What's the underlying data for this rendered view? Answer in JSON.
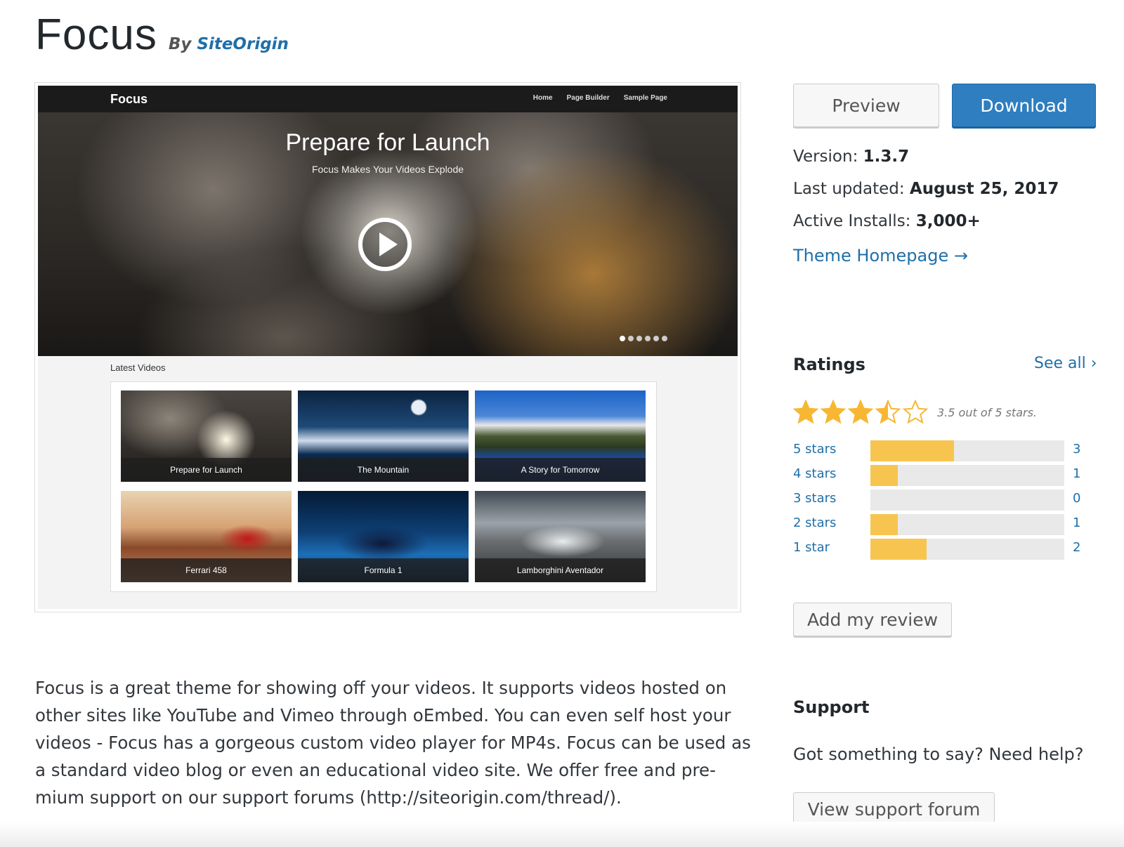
{
  "header": {
    "theme_name": "Focus",
    "by_label": "By",
    "author": "SiteOrigin"
  },
  "screenshot": {
    "site_title": "Focus",
    "menu": [
      "Home",
      "Page Builder",
      "Sample Page"
    ],
    "hero_title": "Prepare for Launch",
    "hero_subtitle": "Focus Makes Your Videos Explode",
    "slider_dots": 6,
    "latest_label": "Latest Videos",
    "videos": [
      "Prepare for Launch",
      "The Mountain",
      "A Story for Tomorrow",
      "Ferrari 458",
      "Formula 1",
      "Lamborghini Aventador"
    ]
  },
  "actions": {
    "preview_label": "Preview",
    "download_label": "Download"
  },
  "meta": {
    "version_label": "Version:",
    "version": "1.3.7",
    "updated_label": "Last updated:",
    "updated": "August 25, 2017",
    "installs_label": "Active Installs:",
    "installs": "3,000+",
    "homepage_label": "Theme Homepage →"
  },
  "ratings": {
    "title": "Ratings",
    "see_all": "See all ›",
    "average": 3.5,
    "stars_text": "3.5 out of 5 stars.",
    "rows": [
      {
        "label": "5 stars",
        "count": "3",
        "fraction": 0.43
      },
      {
        "label": "4 stars",
        "count": "1",
        "fraction": 0.14
      },
      {
        "label": "3 stars",
        "count": "0",
        "fraction": 0
      },
      {
        "label": "2 stars",
        "count": "1",
        "fraction": 0.14
      },
      {
        "label": "1 star",
        "count": "2",
        "fraction": 0.29
      }
    ],
    "add_review_label": "Add my review"
  },
  "support": {
    "title": "Support",
    "text": "Got something to say? Need help?",
    "forum_label": "View support forum"
  },
  "description": "Focus is a great theme for showing off your videos. It supports videos hosted on other sites like YouTube and Vimeo through oEmbed. You can even self host your videos - Focus has a gorgeous custom video player for MP4s. Focus can be used as a standard video blog or even an educational video site. We offer free and pre­mium support on our support forums (http://siteorigin.com/thread/).",
  "colors": {
    "link": "#1f6fa8",
    "primary": "#2e7ec0",
    "star": "#f7b733",
    "bar_fill": "#f7c54f"
  }
}
